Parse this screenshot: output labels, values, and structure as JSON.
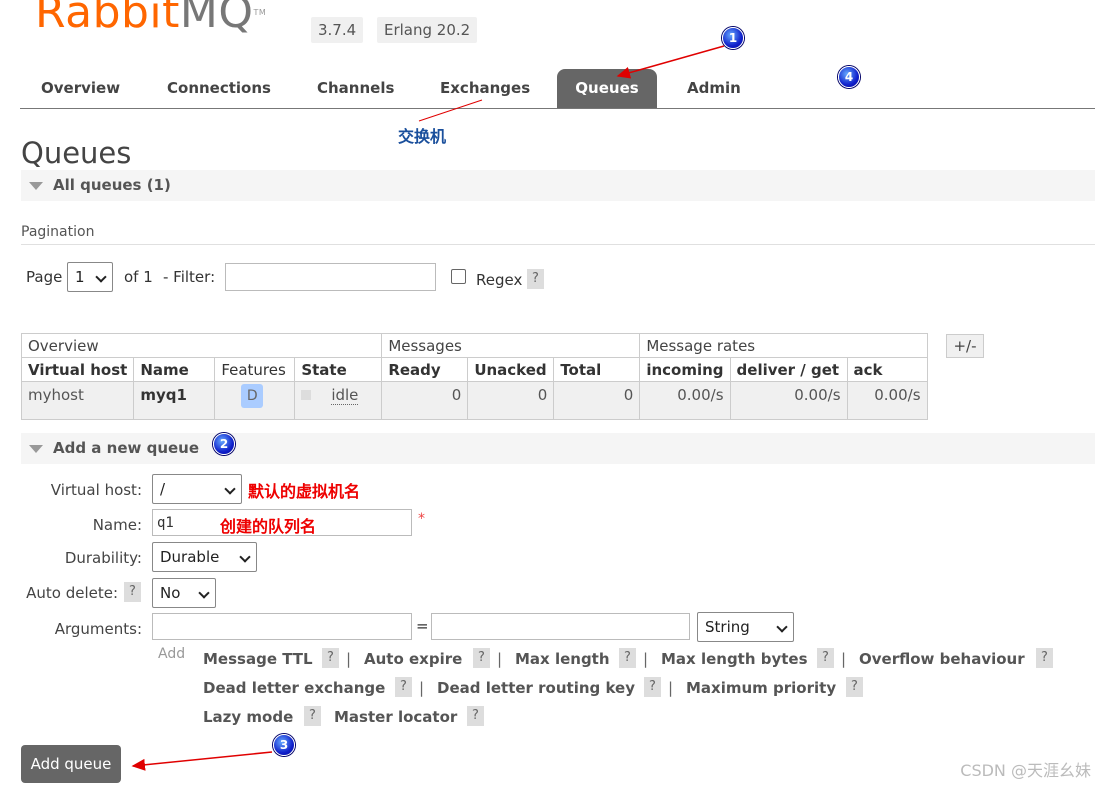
{
  "header": {
    "logo_rabbit": "Rabbit",
    "logo_mq": "MQ",
    "logo_tm": "TM",
    "rabbit_version": "3.7.4",
    "erlang_version": "Erlang 20.2"
  },
  "nav": {
    "tabs": [
      "Overview",
      "Connections",
      "Channels",
      "Exchanges",
      "Queues",
      "Admin"
    ],
    "active": "Queues"
  },
  "page_title": "Queues",
  "all_queues_title": "All queues (1)",
  "pagination": {
    "label": "Pagination",
    "page_label": "Page",
    "page_value": "1",
    "of_label": "of 1",
    "filter_label": "- Filter:",
    "filter_value": "",
    "regex_label": "Regex",
    "help": "?"
  },
  "table": {
    "groups": [
      "Overview",
      "Messages",
      "Message rates"
    ],
    "plus_minus": "+/-",
    "columns": [
      "Virtual host",
      "Name",
      "Features",
      "State",
      "Ready",
      "Unacked",
      "Total",
      "incoming",
      "deliver / get",
      "ack"
    ],
    "rows": [
      {
        "vhost": "myhost",
        "name": "myq1",
        "feature": "D",
        "state": "idle",
        "ready": "0",
        "unacked": "0",
        "total": "0",
        "incoming": "0.00/s",
        "deliver": "0.00/s",
        "ack": "0.00/s"
      }
    ]
  },
  "add_queue": {
    "title": "Add a new queue",
    "vhost_label": "Virtual host:",
    "vhost_value": "/",
    "name_label": "Name:",
    "name_value": "q1",
    "required_mark": "*",
    "durability_label": "Durability:",
    "durability_value": "Durable",
    "auto_delete_label": "Auto delete:",
    "auto_delete_value": "No",
    "arguments_label": "Arguments:",
    "equals": "=",
    "arg_type": "String",
    "add_link": "Add",
    "arg_links": [
      "Message TTL",
      "Auto expire",
      "Max length",
      "Max length bytes",
      "Overflow behaviour",
      "Dead letter exchange",
      "Dead letter routing key",
      "Maximum priority",
      "Lazy mode",
      "Master locator"
    ],
    "separator": "|",
    "help": "?",
    "submit_label": "Add queue"
  },
  "annotations": {
    "exchange_note": "交换机",
    "default_vhost_note": "默认的虚拟机名",
    "queue_name_note": "创建的队列名",
    "markers": [
      "1",
      "2",
      "3",
      "4"
    ],
    "arrow_color": "#e00000"
  },
  "watermark": "CSDN @天涯幺妹"
}
